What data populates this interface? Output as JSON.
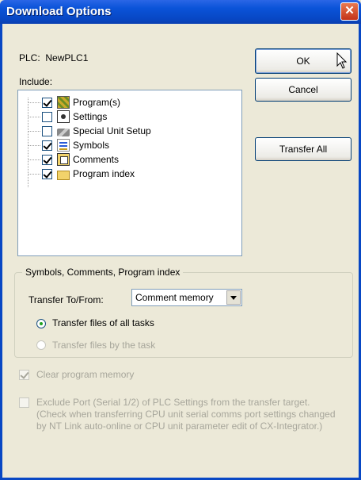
{
  "window": {
    "title": "Download Options",
    "close_glyph": "✕"
  },
  "plc": {
    "label": "PLC:",
    "name": "NewPLC1"
  },
  "include": {
    "label": "Include:",
    "items": [
      {
        "label": "Program(s)",
        "checked": true,
        "icon": "program-icon"
      },
      {
        "label": "Settings",
        "checked": false,
        "icon": "settings-icon"
      },
      {
        "label": "Special Unit Setup",
        "checked": false,
        "icon": "special-unit-icon"
      },
      {
        "label": "Symbols",
        "checked": true,
        "icon": "symbols-icon"
      },
      {
        "label": "Comments",
        "checked": true,
        "icon": "comments-icon"
      },
      {
        "label": "Program index",
        "checked": true,
        "icon": "folder-icon"
      }
    ]
  },
  "buttons": {
    "ok": "OK",
    "cancel": "Cancel",
    "transfer_all": "Transfer All"
  },
  "group": {
    "title": "Symbols, Comments, Program index",
    "transfer_label": "Transfer To/From:",
    "transfer_value": "Comment memory",
    "radio_all": "Transfer files of all tasks",
    "radio_task": "Transfer files by the task"
  },
  "options": {
    "clear_memory": "Clear program memory",
    "exclude_port": "Exclude Port (Serial 1/2) of PLC Settings from the transfer target. (Check when transferring CPU unit serial comms port settings changed by NT Link auto-online or CPU unit parameter edit of CX-Integrator.)"
  },
  "colors": {
    "title_bar": "#0a53d8",
    "dialog_bg": "#ece9d8",
    "check_green": "#21a121"
  }
}
